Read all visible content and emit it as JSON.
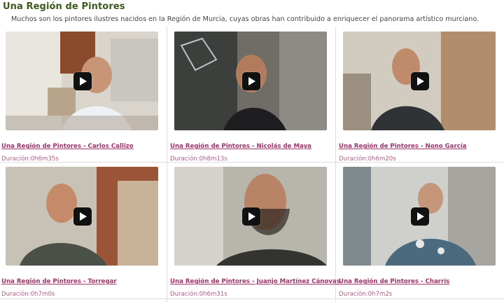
{
  "section": {
    "title": "Una Región de Pintores",
    "intro": "Muchos son los pintores ilustres nacidos en la Región de Murcia, cuyas obras han contribuido a enriquecer el panorama artístico murciano."
  },
  "videos": [
    {
      "title": "Una Región de Pintores - Carlos Callizo",
      "duration": "Duración:0h6m35s"
    },
    {
      "title": "Una Región de Pintores - Nicolás de Maya",
      "duration": "Duración:0h8m13s"
    },
    {
      "title": "Una Región de Pintores - Nono García",
      "duration": "Duración:0h6m20s"
    },
    {
      "title": "Una Región de Pintores - Torregar",
      "duration": "Duración:0h7m0s"
    },
    {
      "title": "Una Región de Pintores - Juanjo Martínez Cánovas",
      "duration": "Duración:0h6m31s"
    },
    {
      "title": "Una Región de Pintores - Charris",
      "duration": "Duración:0h7m2s"
    }
  ],
  "icons": {
    "play": "play-icon"
  },
  "colors": {
    "heading": "#3a5a1a",
    "link": "#a0336b",
    "duration": "#b35c86"
  }
}
